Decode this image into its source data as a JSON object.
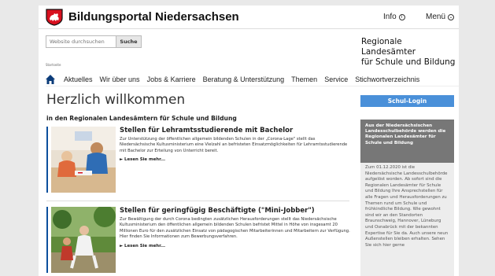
{
  "header": {
    "portal_title": "Bildungsportal Niedersachsen",
    "info_label": "Info",
    "menu_label": "Menü"
  },
  "search": {
    "placeholder": "Website durchsuchen",
    "button_label": "Suche"
  },
  "brand": {
    "line1": "Regionale Landesämter",
    "line2": "für Schule und Bildung"
  },
  "breadcrumb": "Startseite",
  "nav": {
    "items": [
      "Aktuelles",
      "Wir über uns",
      "Jobs & Karriere",
      "Beratung & Unterstützung",
      "Themen",
      "Service",
      "Stichwortverzeichnis"
    ]
  },
  "main": {
    "title": "Herzlich willkommen",
    "subtitle": "in den Regionalen Landesämtern für Schule und Bildung",
    "teasers": [
      {
        "title": "Stellen für Lehramtsstudierende mit Bachelor",
        "text": "Zur Unterstützung der öffentlichen allgemein bildenden Schulen in der „Corona-Lage\" stellt das Niedersächsische Kultusministerium eine Vielzahl an befristeten Einsatzmöglichkeiten für Lehramtsstudierende mit Bachelor zur Erteilung von Unterricht bereit.",
        "more": "► Lesen Sie mehr..."
      },
      {
        "title": "Stellen für geringfügig Beschäftigte (\"Mini-Jobber\")",
        "text": "Zur Bewältigung der durch Corona bedingten zusätzlichen Herausforderungen stellt das Niedersächsische Kultusministerium den öffentlichen allgemein bildenden Schulen befristet Mittel in Höhe von insgesamt 20 Millionen Euro für den zusätzlichen Einsatz von pädagogischen Mitarbeiterinnen und Mitarbeitern zur Verfügung. Hier finden Sie Informationen zum Bewerbungsverfahren.",
        "more": "► Lesen Sie mehr..."
      }
    ]
  },
  "sidebar": {
    "login_label": "Schul-Login",
    "box_title": "Aus der Niedersächsischen Landesschulbehörde werden die Regionalen Landesämter für Schule und Bildung",
    "box_text": "Zum 01.12.2020 ist die Niedersächsische Landesschulbehörde aufgelöst worden. Ab sofort sind die Regionalen Landesämter für Schule und Bildung Ihre Ansprechstellen für alle Fragen und Herausforderungen zu Themen rund um Schule und frühkindliche Bildung. Wie gewohnt sind wir an den Standorten Braunschweig, Hannover, Lüneburg und Osnabrück mit der bekannten Expertise für Sie da. Auch unsere neun Außenstellen bleiben erhalten. Sehen Sie sich hier gerne"
  },
  "colors": {
    "accent_blue": "#4a90d9",
    "teaser_bar": "#0c4f9c",
    "logo_red": "#d8101f",
    "sidebar_head": "#777777"
  }
}
